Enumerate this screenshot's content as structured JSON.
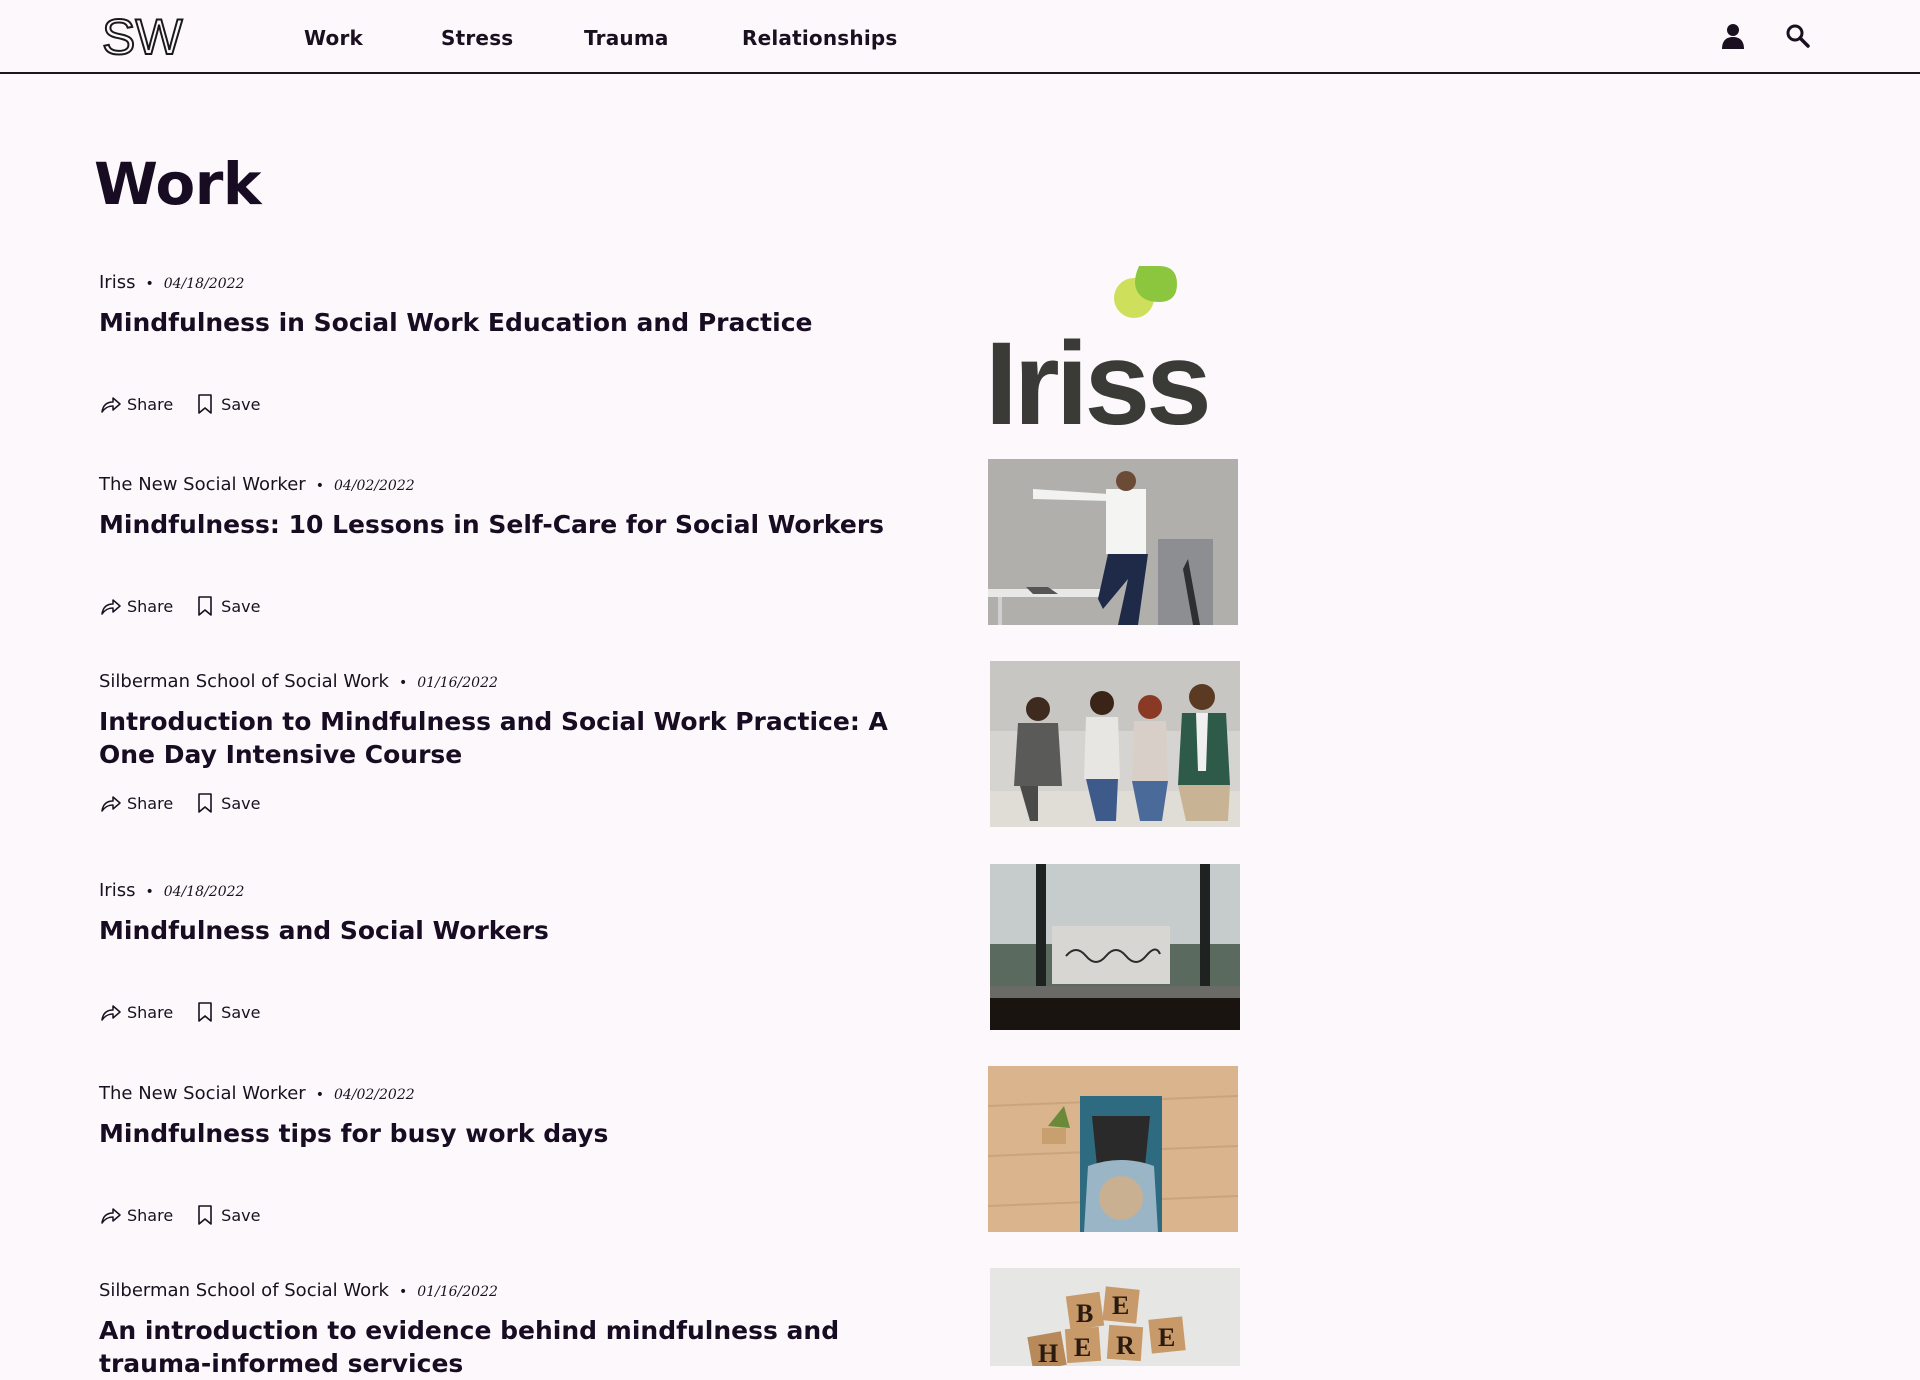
{
  "header": {
    "logo": "SW",
    "nav": [
      "Work",
      "Stress",
      "Trauma",
      "Relationships"
    ],
    "user_icon": "user-icon",
    "search_icon": "search-icon"
  },
  "page": {
    "title": "Work"
  },
  "actions": {
    "share": "Share",
    "save": "Save"
  },
  "articles": [
    {
      "source": "Iriss",
      "date": "04/18/2022",
      "title": "Mindfulness in Social Work Education and Practice",
      "image": "iriss-logo"
    },
    {
      "source": "The New Social Worker",
      "date": "04/02/2022",
      "title": "Mindfulness: 10 Lessons in Self-Care for Social Workers",
      "image": "man-stretching-office"
    },
    {
      "source": "Silberman School of Social Work",
      "date": "01/16/2022",
      "title": "Introduction to Mindfulness and Social Work Practice: A One Day Intensive Course",
      "image": "group-discussion"
    },
    {
      "source": "Iriss",
      "date": "04/18/2022",
      "title": "Mindfulness and Social Workers",
      "image": "mindfulness-sign-window"
    },
    {
      "source": "The New Social Worker",
      "date": "04/02/2022",
      "title": "Mindfulness tips for busy work days",
      "image": "person-yoga-mat"
    },
    {
      "source": "Silberman School of Social Work",
      "date": "01/16/2022",
      "title": "An introduction to evidence behind mindfulness and trauma-informed services",
      "image": "scrabble-be-here-now"
    }
  ],
  "colors": {
    "background": "#fcf8fc",
    "text": "#180c22",
    "iriss_dark": "#3a3a36",
    "iriss_green": "#8cc63f",
    "iriss_lime": "#c9dc4a"
  }
}
